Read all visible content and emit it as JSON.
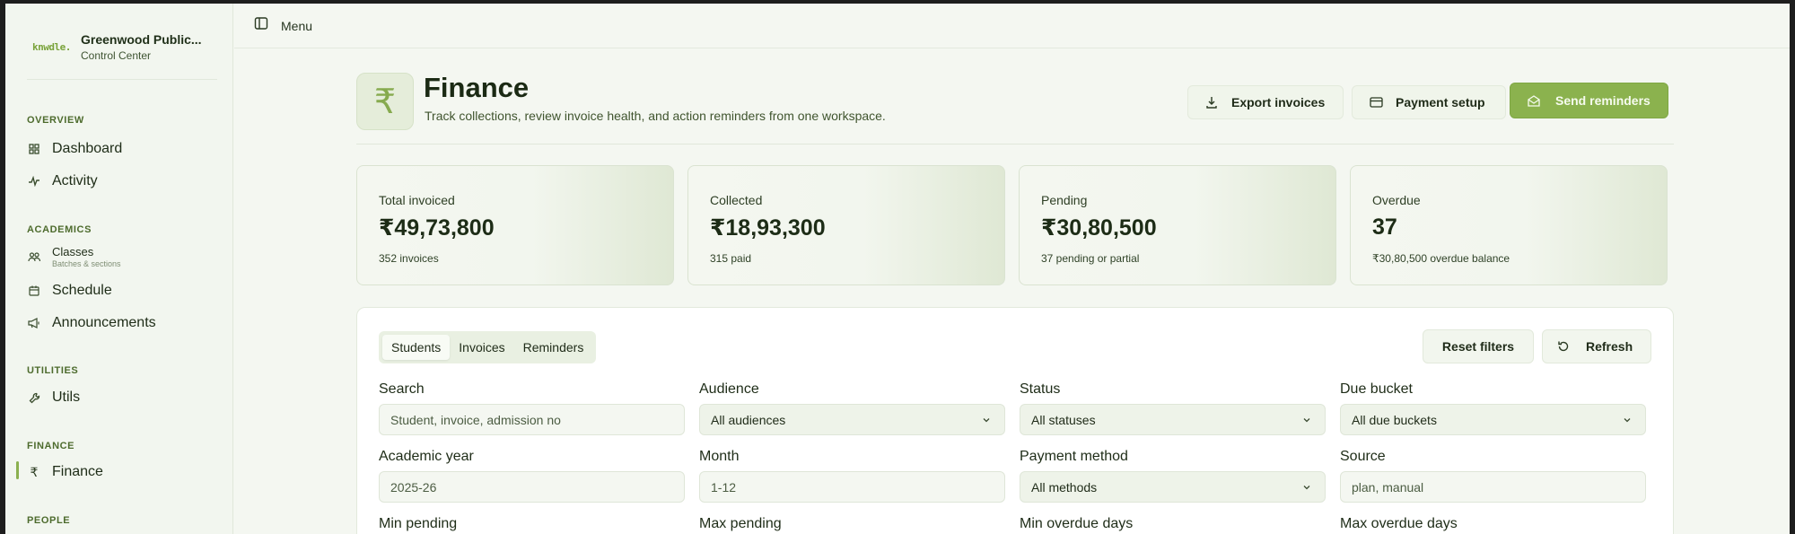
{
  "brand": {
    "logo_text": "knwdle.",
    "name": "Greenwood Public...",
    "subtitle": "Control Center"
  },
  "sidebar": {
    "sections": [
      {
        "label": "OVERVIEW"
      },
      {
        "label": "ACADEMICS"
      },
      {
        "label": "UTILITIES"
      },
      {
        "label": "FINANCE"
      },
      {
        "label": "PEOPLE"
      }
    ],
    "items": [
      {
        "label": "Dashboard",
        "icon": "grid-icon"
      },
      {
        "label": "Activity",
        "icon": "activity-icon"
      },
      {
        "label": "Classes",
        "sublabel": "Batches & sections",
        "icon": "users-icon"
      },
      {
        "label": "Schedule",
        "icon": "calendar-icon"
      },
      {
        "label": "Announcements",
        "icon": "megaphone-icon"
      },
      {
        "label": "Utils",
        "icon": "wrench-icon"
      },
      {
        "label": "Finance",
        "icon": "rupee-icon",
        "active": true
      }
    ]
  },
  "topbar": {
    "menu_label": "Menu"
  },
  "header": {
    "icon_glyph": "₹",
    "title": "Finance",
    "subtitle": "Track collections, review invoice health, and action reminders from one workspace.",
    "buttons": {
      "export": "Export invoices",
      "payment_setup": "Payment setup",
      "send_reminders": "Send reminders"
    }
  },
  "stats": [
    {
      "label": "Total invoiced",
      "value": "₹49,73,800",
      "sub": "352 invoices"
    },
    {
      "label": "Collected",
      "value": "₹18,93,300",
      "sub": "315 paid"
    },
    {
      "label": "Pending",
      "value": "₹30,80,500",
      "sub": "37 pending or partial"
    },
    {
      "label": "Overdue",
      "value": "37",
      "sub": "₹30,80,500 overdue balance"
    }
  ],
  "filters": {
    "tabs": [
      {
        "label": "Students",
        "active": true
      },
      {
        "label": "Invoices"
      },
      {
        "label": "Reminders"
      }
    ],
    "reset_label": "Reset filters",
    "refresh_label": "Refresh",
    "fields": {
      "search": {
        "label": "Search",
        "placeholder": "Student, invoice, admission no"
      },
      "audience": {
        "label": "Audience",
        "value": "All audiences"
      },
      "status": {
        "label": "Status",
        "value": "All statuses"
      },
      "due_bucket": {
        "label": "Due bucket",
        "value": "All due buckets"
      },
      "academic_year": {
        "label": "Academic year",
        "placeholder": "2025-26"
      },
      "month": {
        "label": "Month",
        "placeholder": "1-12"
      },
      "payment_method": {
        "label": "Payment method",
        "value": "All methods"
      },
      "source": {
        "label": "Source",
        "placeholder": "plan, manual"
      },
      "min_pending": {
        "label": "Min pending"
      },
      "max_pending": {
        "label": "Max pending"
      },
      "min_overdue_days": {
        "label": "Min overdue days"
      },
      "max_overdue_days": {
        "label": "Max overdue days"
      }
    }
  },
  "colors": {
    "accent": "#8bb24e",
    "background": "#f4f7f1",
    "text": "#1f2b18"
  }
}
